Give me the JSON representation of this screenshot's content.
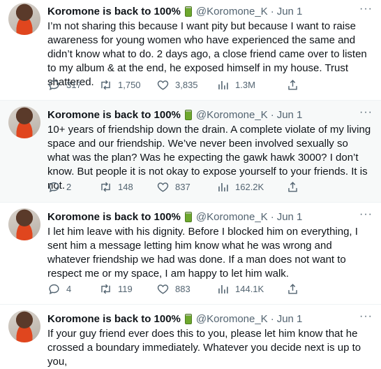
{
  "author": {
    "name": "Koromone is back to 100%",
    "handle": "@Koromone_K",
    "separator": "·",
    "date": "Jun 1"
  },
  "more_label": "···",
  "icons": {
    "battery": "battery-icon",
    "reply": "reply-icon",
    "retweet": "retweet-icon",
    "like": "heart-icon",
    "views": "views-icon",
    "share": "share-icon",
    "more": "more-icon"
  },
  "tweets": [
    {
      "text": "I’m not sharing this because I want pity but because I want to raise awareness for young women who have experienced the same and didn’t know what to do. 2 days ago, a close friend came over to listen to my album & at the end, he exposed himself in my house. Trust shattered.",
      "replies": "317",
      "retweets": "1,750",
      "likes": "3,835",
      "views": "1.3M"
    },
    {
      "text": "10+ years of friendship down the drain. A complete violate of my living space and our friendship. We’ve never been involved sexually so what was the plan? Was he expecting the gawk hawk 3000? I don’t know. But people it is not okay to expose yourself to your friends. It is not.",
      "replies": "2",
      "retweets": "148",
      "likes": "837",
      "views": "162.2K"
    },
    {
      "text": "I let him leave with his dignity. Before I blocked him on everything, I sent him a message letting him know what he was wrong and whatever friendship we had was done. If a man does not want to respect me or my space, I am happy to let him walk.",
      "replies": "4",
      "retweets": "119",
      "likes": "883",
      "views": "144.1K"
    },
    {
      "text": "If your guy friend ever does this to you, please let him know that he crossed a boundary immediately. Whatever you decide next is up to you,"
    }
  ]
}
